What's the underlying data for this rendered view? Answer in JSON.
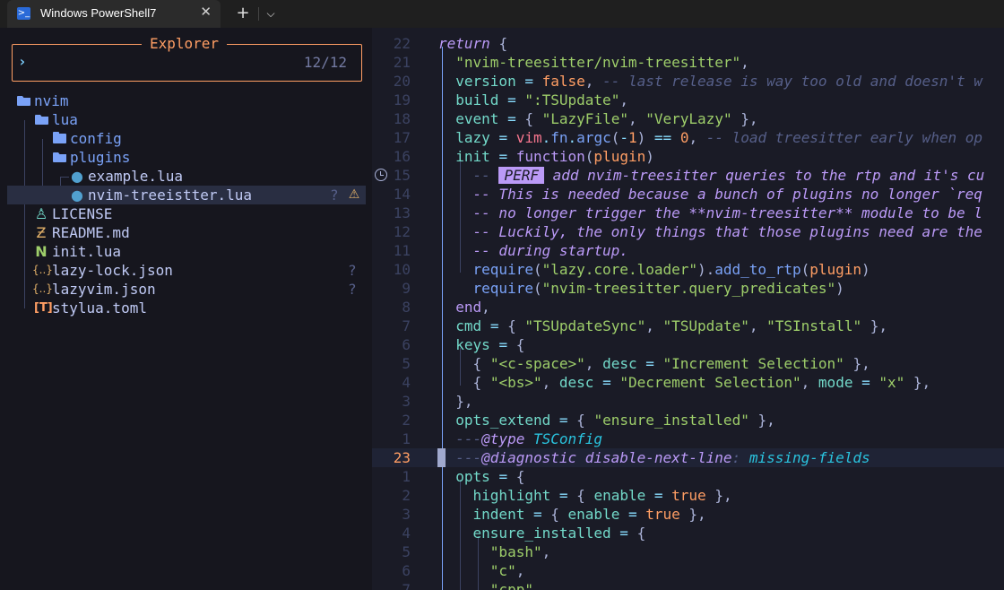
{
  "window": {
    "tab_title": "Windows PowerShell7",
    "tab_icon": "powershell-icon",
    "close_symbol": "✕",
    "new_tab_symbol": "+",
    "dropdown_symbol": "⌄"
  },
  "explorer": {
    "title": "Explorer",
    "prompt": "›",
    "count": "12/12",
    "items": [
      {
        "label": "nvim",
        "icon": "folder-open-icon",
        "status": ""
      },
      {
        "label": "lua",
        "icon": "folder-open-icon",
        "status": ""
      },
      {
        "label": "config",
        "icon": "folder-icon",
        "status": ""
      },
      {
        "label": "plugins",
        "icon": "folder-open-icon",
        "status": ""
      },
      {
        "label": "example.lua",
        "icon": "lua-file-icon",
        "status": ""
      },
      {
        "label": "nvim-treeistter.lua",
        "icon": "lua-file-icon",
        "status": "?",
        "warning": "⚠"
      },
      {
        "label": "LICENSE",
        "icon": "license-icon",
        "status": ""
      },
      {
        "label": "README.md",
        "icon": "markdown-icon",
        "status": ""
      },
      {
        "label": "init.lua",
        "icon": "neovim-icon",
        "status": ""
      },
      {
        "label": "lazy-lock.json",
        "icon": "json-icon",
        "status": "?"
      },
      {
        "label": "lazyvim.json",
        "icon": "json-icon",
        "status": "?"
      },
      {
        "label": "stylua.toml",
        "icon": "toml-icon",
        "status": ""
      }
    ]
  },
  "editor": {
    "line_numbers": [
      "22",
      "21",
      "20",
      "19",
      "18",
      "17",
      "16",
      "15",
      "14",
      "13",
      "12",
      "11",
      "10",
      "9",
      "8",
      "7",
      "6",
      "5",
      "4",
      "3",
      "2",
      "1",
      "23",
      "1",
      "2",
      "3",
      "4",
      "5",
      "6",
      "7"
    ],
    "current_line": "23",
    "colors": {
      "accent": "#ff9e64",
      "background": "#1a1b26",
      "keyword": "#bb9af7",
      "string": "#9ece6a"
    }
  }
}
